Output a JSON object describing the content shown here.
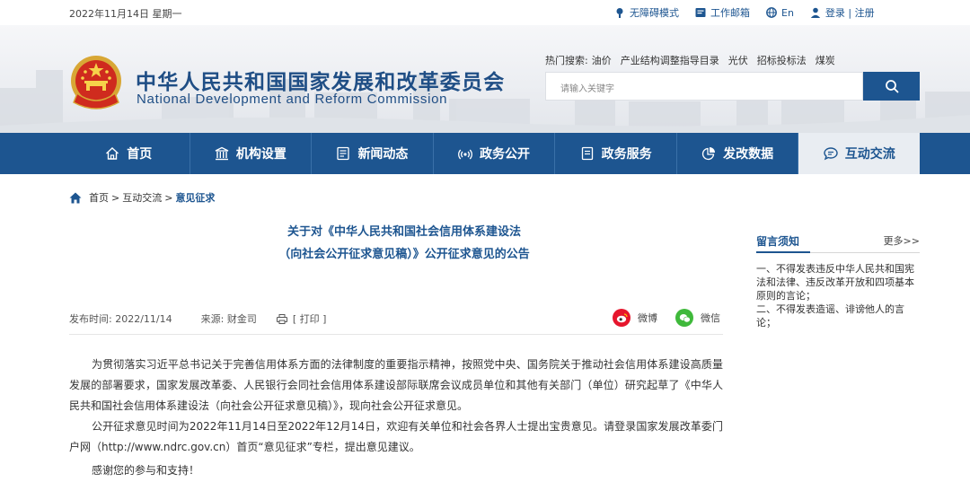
{
  "topbar": {
    "date": "2022年11月14日 星期一",
    "links": [
      {
        "label": "无障碍模式",
        "icon": "accessibility-icon"
      },
      {
        "label": "工作邮箱",
        "icon": "mail-icon"
      },
      {
        "label": "En",
        "icon": "globe-icon"
      },
      {
        "label": "登录 | 注册",
        "icon": "user-icon"
      }
    ]
  },
  "header": {
    "org_cn": "中华人民共和国国家发展和改革委员会",
    "org_en": "National Development and Reform Commission",
    "hot_label": "热门搜索:",
    "hot_items": [
      "油价",
      "产业结构调整指导目录",
      "光伏",
      "招标投标法",
      "煤炭"
    ],
    "search_placeholder": "请输入关键字"
  },
  "nav": {
    "items": [
      {
        "label": "首页",
        "icon": "home-icon"
      },
      {
        "label": "机构设置",
        "icon": "building-icon"
      },
      {
        "label": "新闻动态",
        "icon": "news-icon"
      },
      {
        "label": "政务公开",
        "icon": "broadcast-icon"
      },
      {
        "label": "政务服务",
        "icon": "document-icon"
      },
      {
        "label": "发改数据",
        "icon": "pie-chart-icon"
      },
      {
        "label": "互动交流",
        "icon": "chat-icon"
      }
    ],
    "active_index": 6
  },
  "breadcrumb": {
    "items": [
      "首页",
      "互动交流",
      "意见征求"
    ],
    "separator": ">"
  },
  "article": {
    "title_line1": "关于对《中华人民共和国社会信用体系建设法",
    "title_line2": "（向社会公开征求意见稿）》公开征求意见的公告",
    "publish_label": "发布时间:",
    "publish_date": "2022/11/14",
    "source_label": "来源:",
    "source": "财金司",
    "print_label": "[ 打印 ]",
    "share_weibo": "微博",
    "share_wechat": "微信",
    "paragraphs": [
      "为贯彻落实习近平总书记关于完善信用体系方面的法律制度的重要指示精神，按照党中央、国务院关于推动社会信用体系建设高质量发展的部署要求，国家发展改革委、人民银行会同社会信用体系建设部际联席会议成员单位和其他有关部门（单位）研究起草了《中华人民共和国社会信用体系建设法（向社会公开征求意见稿）》，现向社会公开征求意见。",
      "公开征求意见时间为2022年11月14日至2022年12月14日，欢迎有关单位和社会各界人士提出宝贵意见。请登录国家发展改革委门户网（http://www.ndrc.gov.cn）首页“意见征求”专栏，提出意见建议。"
    ],
    "thanks": "感谢您的参与和支持！"
  },
  "sidebar": {
    "title": "留言须知",
    "more": "更多>>",
    "notes": [
      "一、不得发表违反中华人民共和国宪法和法律、违反改革开放和四项基本原则的言论；",
      "二、不得发表造谣、诽谤他人的言论；"
    ]
  },
  "colors": {
    "brand_blue": "#1d5590",
    "nav_active_bg": "#e9edf2"
  }
}
